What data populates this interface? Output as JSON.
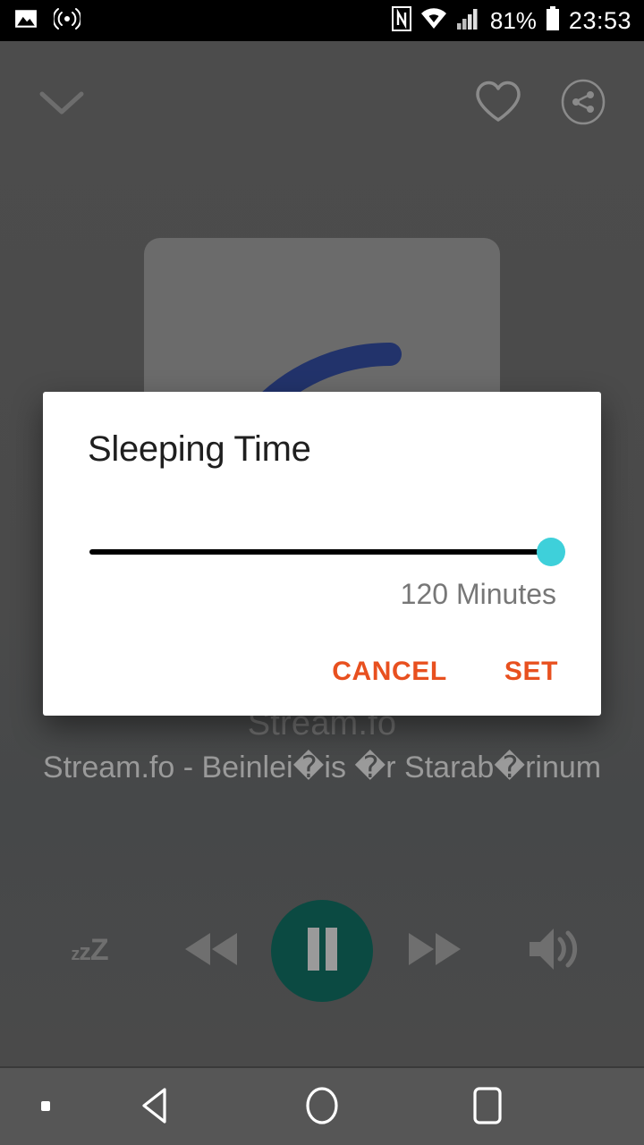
{
  "status_bar": {
    "icons_left": [
      "image-icon",
      "cast-icon"
    ],
    "icons_right": [
      "nfc-icon",
      "wifi-icon",
      "signal-icon",
      "battery-icon"
    ],
    "battery_percent": "81%",
    "clock": "23:53"
  },
  "player": {
    "collapse_icon": "chevron-down-icon",
    "favorite_icon": "heart-icon",
    "share_icon": "share-icon",
    "album_art_icon": "radio-wave-artwork",
    "track_title": "Stream.fo",
    "track_subtitle": "Stream.fo - Beinlei�is �r Starab�rinum",
    "controls": {
      "sleep_label": "zzZ",
      "sleep_icon": "sleep-timer-icon",
      "rewind_icon": "rewind-icon",
      "play_icon": "pause-icon",
      "forward_icon": "fast-forward-icon",
      "volume_icon": "volume-icon",
      "play_button_color": "#0b4a42"
    }
  },
  "dialog": {
    "title": "Sleeping Time",
    "slider": {
      "value_label": "120 Minutes",
      "value": 120,
      "min": 0,
      "max": 120,
      "percent": 100,
      "thumb_color": "#3ed0da",
      "track_color": "#000000"
    },
    "cancel_label": "CANCEL",
    "set_label": "SET",
    "action_color": "#e8501f"
  },
  "navbar": {
    "dot_icon": "square-dot-icon",
    "back_icon": "back-triangle-icon",
    "home_icon": "home-circle-icon",
    "recents_icon": "recents-square-icon"
  }
}
